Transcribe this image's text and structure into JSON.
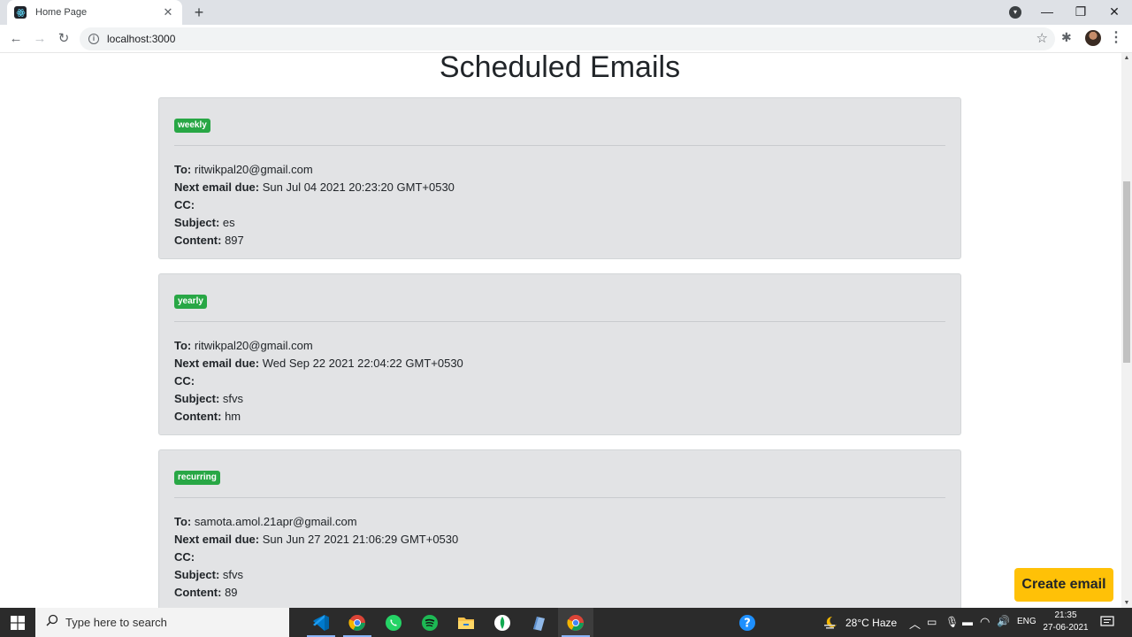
{
  "browser": {
    "tab_title": "Home Page",
    "url": "localhost:3000"
  },
  "page": {
    "title": "Scheduled Emails",
    "labels": {
      "to": "To:",
      "next_due": "Next email due:",
      "cc": "CC:",
      "subject": "Subject:",
      "content": "Content:"
    },
    "emails": [
      {
        "frequency": "weekly",
        "to": "ritwikpal20@gmail.com",
        "next_due": "Sun Jul 04 2021 20:23:20 GMT+0530",
        "cc": "",
        "subject": "es",
        "content": "897"
      },
      {
        "frequency": "yearly",
        "to": "ritwikpal20@gmail.com",
        "next_due": "Wed Sep 22 2021 22:04:22 GMT+0530",
        "cc": "",
        "subject": "sfvs",
        "content": "hm"
      },
      {
        "frequency": "recurring",
        "to": "samota.amol.21apr@gmail.com",
        "next_due": "Sun Jun 27 2021 21:06:29 GMT+0530",
        "cc": "",
        "subject": "sfvs",
        "content": "89"
      }
    ],
    "create_button": "Create email"
  },
  "taskbar": {
    "search_placeholder": "Type here to search",
    "weather": "28°C  Haze",
    "language": "ENG",
    "time": "21:35",
    "date": "27-06-2021",
    "apps": [
      "vscode-icon",
      "chrome-icon",
      "whatsapp-icon",
      "spotify-icon",
      "file-explorer-icon",
      "mongodb-compass-icon",
      "notepad-icon",
      "chrome-icon"
    ]
  },
  "colors": {
    "badge": "#28a745",
    "card_bg": "#e2e3e5",
    "create_button": "#ffc107"
  }
}
